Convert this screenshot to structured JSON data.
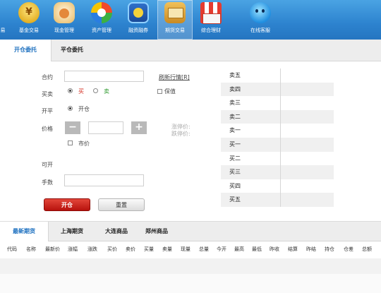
{
  "toolbar": {
    "items": [
      {
        "label": "易",
        "icon": "partial-app-icon"
      },
      {
        "label": "基金交易",
        "icon": "fund-coin-icon"
      },
      {
        "label": "现金管理",
        "icon": "cash-bag-icon"
      },
      {
        "label": "资产管理",
        "icon": "asset-pie-icon"
      },
      {
        "label": "融资融券",
        "icon": "margin-trading-icon"
      },
      {
        "label": "期货交易",
        "icon": "futures-icon"
      },
      {
        "label": "综合理财",
        "icon": "wealth-mall-icon"
      },
      {
        "label": "在线客服",
        "icon": "online-service-icon"
      }
    ],
    "active": "期货交易",
    "colors": {
      "bg_top": "#4aa3e3",
      "bg_bottom": "#2575c0"
    }
  },
  "order_tabs": [
    {
      "label": "开仓委托",
      "active": true
    },
    {
      "label": "平仓委托",
      "active": false
    }
  ],
  "form": {
    "contract_label": "合约",
    "contract_value": "",
    "refresh_link": "刷新行情[R]",
    "direction_label": "买卖",
    "buy_label": "买",
    "sell_label": "卖",
    "hedge_label": "保值",
    "open_close_label": "开平",
    "open_label": "开仓",
    "price_label": "价格",
    "price_value": "",
    "minus_symbol": "−",
    "plus_symbol": "+",
    "limit_up_label": "涨停价:",
    "limit_down_label": "跌停价:",
    "market_price_label": "市价",
    "available_label": "可开",
    "quantity_label": "手数",
    "quantity_value": "",
    "submit_label": "开仓",
    "reset_label": "重置",
    "colors": {
      "buy": "#d42b1e",
      "sell": "#2e9a2e",
      "submit": "#c91c14",
      "link": "#444444"
    }
  },
  "order_book": {
    "rows": [
      "卖五",
      "卖四",
      "卖三",
      "卖二",
      "卖一",
      "买一",
      "买二",
      "买三",
      "买四",
      "买五"
    ]
  },
  "market_tabs": [
    {
      "label": "最新期货",
      "active": true
    },
    {
      "label": "上海期货",
      "active": false
    },
    {
      "label": "大连商品",
      "active": false
    },
    {
      "label": "郑州商品",
      "active": false
    }
  ],
  "market_columns": [
    "代码",
    "名称",
    "最新价",
    "涨幅",
    "涨跌",
    "买价",
    "卖价",
    "买量",
    "卖量",
    "现量",
    "总量",
    "今开",
    "最高",
    "最低",
    "昨收",
    "结算",
    "昨结",
    "持仓",
    "仓差",
    "总额"
  ]
}
